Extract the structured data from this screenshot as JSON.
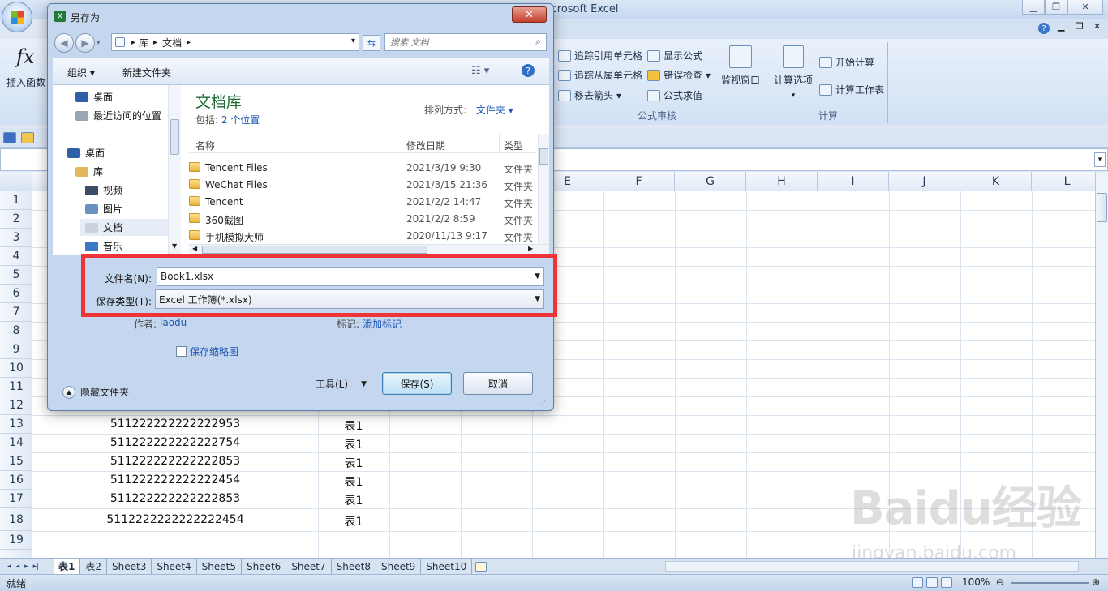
{
  "excel": {
    "title_suffix": "icrosoft Excel",
    "ribbon": {
      "insert_function": "插入函数",
      "trace_precedents": "追踪引用单元格",
      "trace_dependents": "追踪从属单元格",
      "remove_arrows": "移去箭头",
      "show_formulas": "显示公式",
      "error_checking": "错误检查",
      "evaluate_formula": "公式求值",
      "watch_window": "监视窗口",
      "calc_options": "计算选项",
      "calc_now": "开始计算",
      "calc_sheet": "计算工作表",
      "group_audit": "公式审核",
      "group_calc": "计算"
    },
    "columns": [
      "E",
      "F",
      "G",
      "H",
      "I",
      "J",
      "K",
      "L"
    ],
    "rows": [
      "1",
      "2",
      "3",
      "4",
      "5",
      "6",
      "7",
      "8",
      "9",
      "10",
      "11",
      "12",
      "13",
      "14",
      "15",
      "16",
      "17",
      "18",
      "19"
    ],
    "visible_cells": [
      {
        "row": "13",
        "id": "511222222222222953",
        "table": "表1"
      },
      {
        "row": "14",
        "id": "511222222222222754",
        "table": "表1"
      },
      {
        "row": "15",
        "id": "511222222222222853",
        "table": "表1"
      },
      {
        "row": "16",
        "id": "511222222222222454",
        "table": "表1"
      },
      {
        "row": "17",
        "id": "511222222222222853",
        "table": "表1"
      },
      {
        "row": "18",
        "id": "5112222222222222454",
        "table": "表1"
      }
    ],
    "sheet_tabs": [
      "表1",
      "表2",
      "Sheet3",
      "Sheet4",
      "Sheet5",
      "Sheet6",
      "Sheet7",
      "Sheet8",
      "Sheet9",
      "Sheet10"
    ],
    "status": "就绪",
    "zoom": "100%",
    "watermark": "Baidu经验",
    "watermark_url": "jingyan.baidu.com"
  },
  "dialog": {
    "title": "另存为",
    "close": "✕",
    "breadcrumb": [
      "库",
      "文档"
    ],
    "search_placeholder": "搜索 文档",
    "organize": "组织 ▾",
    "new_folder": "新建文件夹",
    "nav": [
      {
        "label": "桌面"
      },
      {
        "label": "最近访问的位置"
      },
      {
        "label": "桌面"
      },
      {
        "label": "库"
      },
      {
        "label": "视频"
      },
      {
        "label": "图片"
      },
      {
        "label": "文档"
      },
      {
        "label": "音乐"
      }
    ],
    "library_title": "文档库",
    "library_includes_label": "包括:",
    "library_includes_link": "2 个位置",
    "arrange_label": "排列方式:",
    "arrange_value": "文件夹 ▾",
    "col_name": "名称",
    "col_date": "修改日期",
    "col_type": "类型",
    "files": [
      {
        "name": "Tencent Files",
        "date": "2021/3/19 9:30",
        "type": "文件夹"
      },
      {
        "name": "WeChat Files",
        "date": "2021/3/15 21:36",
        "type": "文件夹"
      },
      {
        "name": "Tencent",
        "date": "2021/2/2 14:47",
        "type": "文件夹"
      },
      {
        "name": "360截图",
        "date": "2021/2/2 8:59",
        "type": "文件夹"
      },
      {
        "name": "手机模拟大师",
        "date": "2020/11/13 9:17",
        "type": "文件夹"
      }
    ],
    "filename_label": "文件名(N):",
    "filename_value": "Book1.xlsx",
    "filetype_label": "保存类型(T):",
    "filetype_value": "Excel 工作簿(*.xlsx)",
    "author_label": "作者:",
    "author_value": "laodu",
    "tags_label": "标记:",
    "tags_value": "添加标记",
    "save_thumbnail": "保存缩略图",
    "hide_folders": "隐藏文件夹",
    "tools": "工具(L)",
    "save": "保存(S)",
    "cancel": "取消"
  }
}
